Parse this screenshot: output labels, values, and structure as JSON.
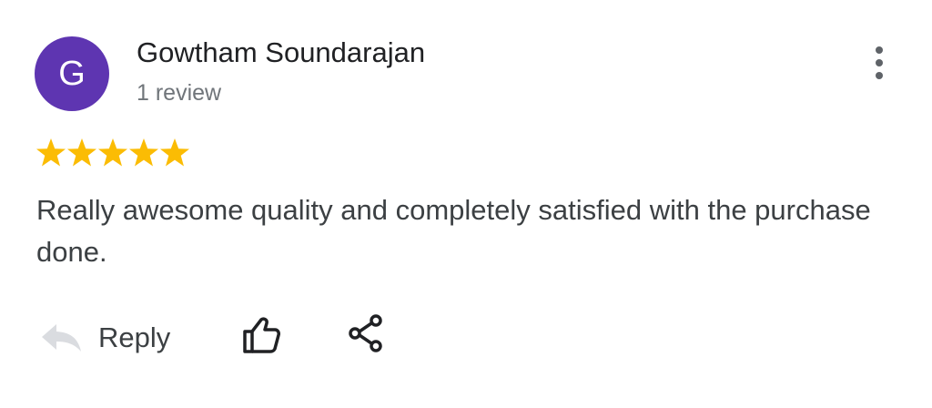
{
  "reviewer": {
    "initial": "G",
    "name": "Gowtham Soundarajan",
    "review_count": "1 review",
    "avatar_color": "#5e35b1"
  },
  "rating": {
    "stars": 5,
    "max_stars": 5,
    "star_color": "#fbbc04"
  },
  "review": {
    "text": "Really awesome quality and completely satisfied with the purchase done."
  },
  "actions": {
    "reply_label": "Reply",
    "reply_icon": "reply-arrow-icon",
    "like_icon": "thumbs-up-icon",
    "share_icon": "share-icon"
  },
  "menu": {
    "icon": "more-vertical-icon"
  }
}
